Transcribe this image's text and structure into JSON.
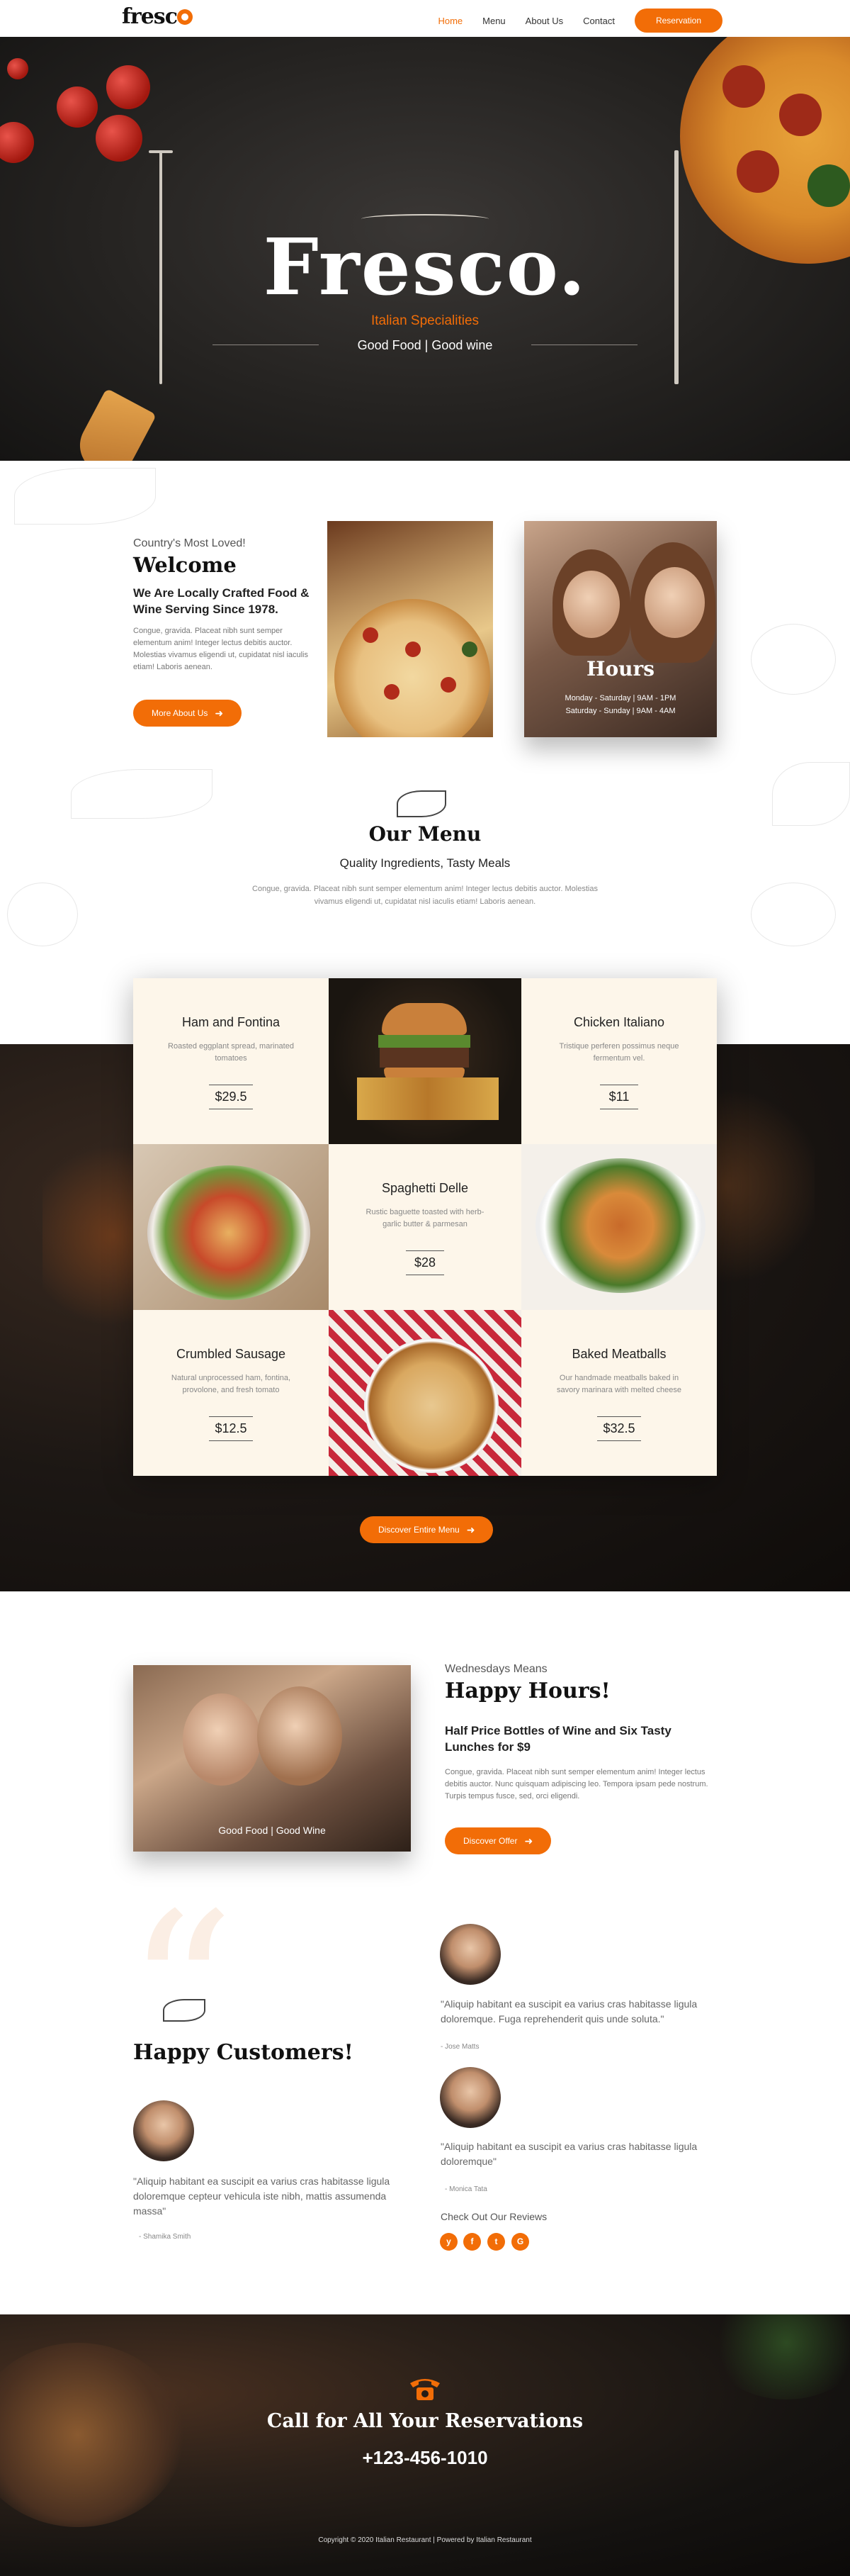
{
  "header": {
    "logo": "fresco",
    "nav": [
      "Home",
      "Menu",
      "About Us",
      "Contact"
    ],
    "reservation": "Reservation"
  },
  "hero": {
    "title": "Fresco.",
    "subtitle": "Italian Specialities",
    "tagline": "Good Food | Good wine"
  },
  "welcome": {
    "small": "Country's Most Loved!",
    "title": "Welcome",
    "sub": "We Are Locally Crafted Food & Wine Serving Since 1978.",
    "body": "Congue, gravida. Placeat nibh sunt semper elementum anim! Integer lectus debitis auctor. Molestias vivamus eligendi ut, cupidatat nisl iaculis etiam! Laboris aenean.",
    "button": "More About Us",
    "hours_title": "Hours",
    "hours": [
      "Monday - Saturday | 9AM - 1PM",
      "Saturday - Sunday | 9AM - 4AM"
    ]
  },
  "menu": {
    "title": "Our Menu",
    "subtitle": "Quality Ingredients, Tasty Meals",
    "body": "Congue, gravida. Placeat nibh sunt semper elementum anim! Integer lectus debitis auctor. Molestias vivamus eligendi ut, cupidatat nisl iaculis etiam! Laboris aenean.",
    "items": [
      {
        "name": "Ham and Fontina",
        "desc": "Roasted eggplant spread, marinated tomatoes",
        "price": "$29.5"
      },
      {
        "name": "Chicken Italiano",
        "desc": "Tristique perferen possimus neque fermentum vel.",
        "price": "$11"
      },
      {
        "name": "Spaghetti Delle",
        "desc": "Rustic baguette toasted with herb-garlic butter & parmesan",
        "price": "$28"
      },
      {
        "name": "Crumbled Sausage",
        "desc": "Natural unprocessed ham, fontina, provolone, and fresh tomato",
        "price": "$12.5"
      },
      {
        "name": "Baked Meatballs",
        "desc": "Our handmade meatballs baked in savory marinara with melted cheese",
        "price": "$32.5"
      }
    ],
    "button": "Discover Entire Menu"
  },
  "happy": {
    "img_caption": "Good Food | Good Wine",
    "small": "Wednesdays Means",
    "title": "Happy Hours!",
    "sub": "Half Price Bottles of Wine and Six Tasty Lunches for $9",
    "body": "Congue, gravida. Placeat nibh sunt semper elementum anim! Integer lectus debitis auctor. Nunc quisquam adipiscing leo. Tempora ipsam pede nostrum. Turpis tempus fusce, sed, orci eligendi.",
    "button": "Discover Offer"
  },
  "customers": {
    "title": "Happy Customers!",
    "reviews": [
      {
        "text": "\"Aliquip habitant ea suscipit ea varius cras habitasse ligula doloremque cepteur vehicula iste nibh, mattis assumenda massa\"",
        "name": "- Shamika Smith"
      },
      {
        "text": "\"Aliquip habitant ea suscipit ea varius cras habitasse ligula doloremque. Fuga reprehenderit quis unde soluta.\"",
        "name": "- Jose Matts"
      },
      {
        "text": "\"Aliquip habitant ea suscipit ea varius cras habitasse ligula doloremque\"",
        "name": "- Monica Tata"
      }
    ],
    "check": "Check Out Our Reviews",
    "social": [
      "Yelp",
      "Facebook",
      "Twitter",
      "Google Plus"
    ]
  },
  "footer": {
    "call": "Call for All Your Reservations",
    "number": "+123-456-1010",
    "copyright": "Copyright © 2020 Italian Restaurant | Powered by Italian Restaurant"
  },
  "colors": {
    "accent": "#f26d07",
    "cream": "#fdf6ea",
    "dark": "#1c1714"
  }
}
